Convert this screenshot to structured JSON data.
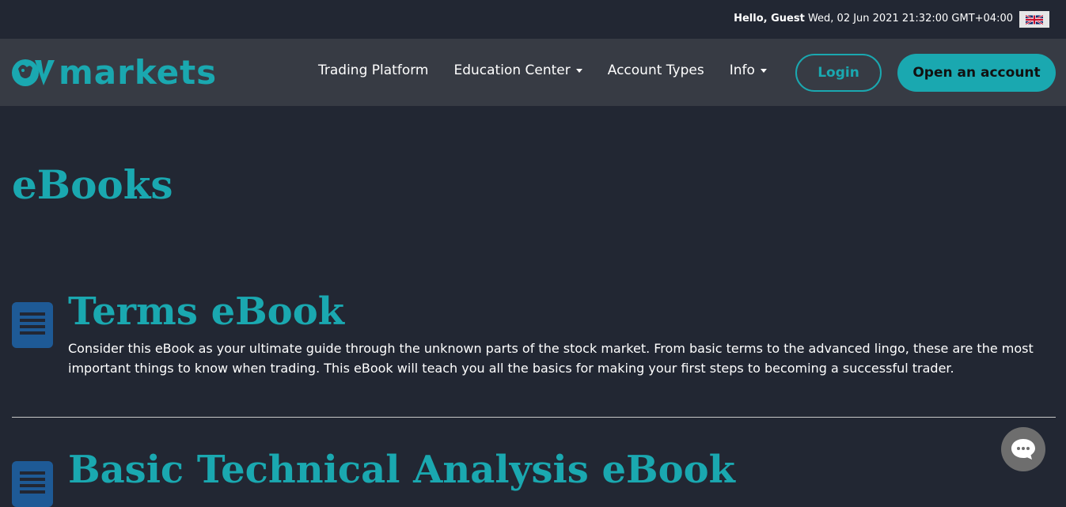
{
  "topbar": {
    "greeting_bold": "Hello, Guest",
    "datetime": "Wed, 02 Jun 2021 21:32:00 GMT+04:00",
    "language_flag_icon": "uk-flag-icon"
  },
  "navbar": {
    "logo_text": "markets",
    "logo_icon": "bull-logo-icon",
    "items": [
      {
        "label": "Trading Platform",
        "has_dropdown": false
      },
      {
        "label": "Education Center",
        "has_dropdown": true
      },
      {
        "label": "Account Types",
        "has_dropdown": false
      },
      {
        "label": "Info",
        "has_dropdown": true
      }
    ],
    "login_label": "Login",
    "open_account_label": "Open an account"
  },
  "page": {
    "title": "eBooks"
  },
  "ebooks": [
    {
      "title": "Terms eBook",
      "description": "Consider this eBook as your ultimate guide through the unknown parts of the stock market. From basic terms to the advanced lingo, these are the most important things to know when trading. This eBook will teach you all the basics for making your first steps to becoming a successful trader."
    },
    {
      "title": "Basic Technical Analysis eBook",
      "description": ""
    }
  ],
  "chat": {
    "icon": "chat-bubble-icon"
  },
  "colors": {
    "background": "#222733",
    "navbar": "#373b44",
    "accent": "#1aa8b0",
    "icon_blue": "#1e5a96"
  }
}
